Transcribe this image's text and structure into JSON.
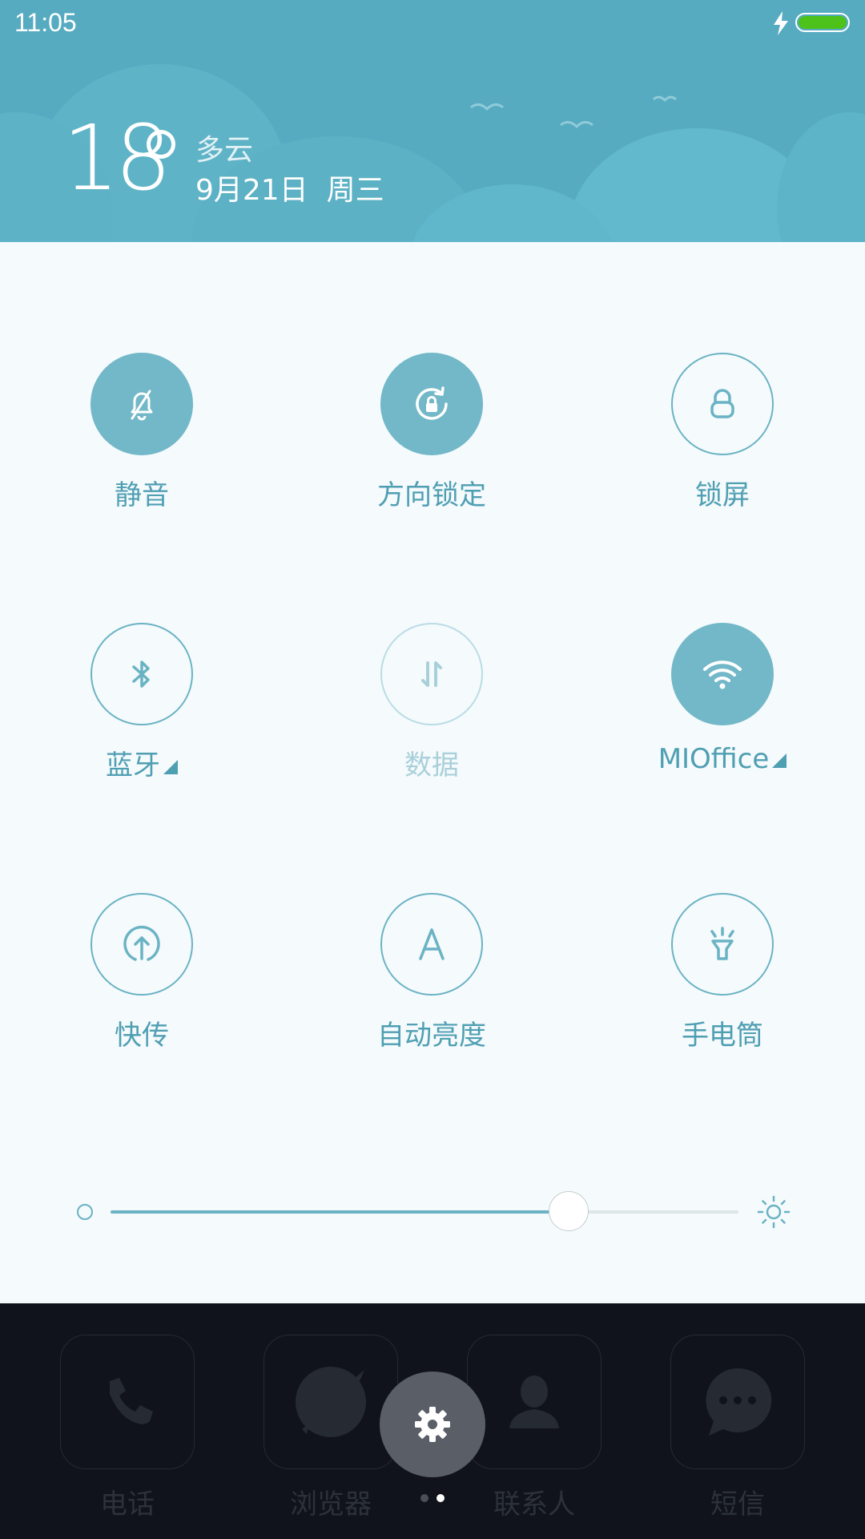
{
  "status_bar": {
    "time": "11:05",
    "battery_color": "#4cc21a",
    "charging": true
  },
  "weather": {
    "temperature": "18",
    "condition": "多云",
    "date": "9月21日  周三"
  },
  "toggles": [
    {
      "label": "静音",
      "icon": "bell-off-icon",
      "state": "on"
    },
    {
      "label": "方向锁定",
      "icon": "rotation-lock-icon",
      "state": "on"
    },
    {
      "label": "锁屏",
      "icon": "lock-icon",
      "state": "off"
    },
    {
      "label": "蓝牙",
      "icon": "bluetooth-icon",
      "state": "off",
      "has_menu": true
    },
    {
      "label": "数据",
      "icon": "data-transfer-icon",
      "state": "disabled"
    },
    {
      "label": "MIOffice",
      "icon": "wifi-icon",
      "state": "on",
      "has_menu": true
    },
    {
      "label": "快传",
      "icon": "upload-icon",
      "state": "off"
    },
    {
      "label": "自动亮度",
      "icon": "auto-brightness-icon",
      "state": "off"
    },
    {
      "label": "手电筒",
      "icon": "flashlight-icon",
      "state": "off"
    }
  ],
  "brightness": {
    "level": 0.73
  },
  "dock": {
    "apps": [
      {
        "label": "电话",
        "icon": "phone-icon"
      },
      {
        "label": "浏览器",
        "icon": "browser-icon"
      },
      {
        "label": "联系人",
        "icon": "contact-icon"
      },
      {
        "label": "短信",
        "icon": "message-icon"
      }
    ],
    "settings_icon": "gear-icon",
    "page_dots": {
      "count": 2,
      "active": 1
    }
  },
  "colors": {
    "accent": "#6ab3c4",
    "header": "#56abc0",
    "dock": "#10131b"
  }
}
